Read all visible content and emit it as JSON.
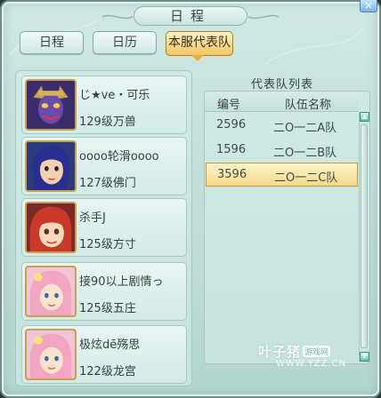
{
  "window": {
    "title": "日程",
    "close_label": "×"
  },
  "tabs": [
    {
      "label": "日程",
      "active": false
    },
    {
      "label": "日历",
      "active": false
    },
    {
      "label": "本服代表队",
      "active": true
    }
  ],
  "members": [
    {
      "name": "じ★ve・可乐",
      "level": "129级万兽",
      "icon": "avatar-demon-icon"
    },
    {
      "name": "oooo轮滑oooo",
      "level": "127级佛门",
      "icon": "avatar-blue-hair-icon"
    },
    {
      "name": "杀手J",
      "level": "125级方寸",
      "icon": "avatar-red-hair-icon"
    },
    {
      "name": "接90以上剧情っ",
      "level": "125级五庄",
      "icon": "avatar-pink-hair-icon"
    },
    {
      "name": "极炫dē殇思",
      "level": "122级龙宫",
      "icon": "avatar-pink-hair-icon"
    }
  ],
  "team_list": {
    "title": "代表队列表",
    "columns": [
      "编号",
      "队伍名称"
    ],
    "rows": [
      {
        "id": "2596",
        "name": "二O一二A队",
        "selected": false
      },
      {
        "id": "1596",
        "name": "二O一二B队",
        "selected": false
      },
      {
        "id": "3596",
        "name": "二O一二C队",
        "selected": true
      }
    ]
  },
  "watermark": {
    "main": "叶子猪",
    "tag": "游戏网",
    "url": "WWW.YZZ.CN"
  },
  "colors": {
    "panel_bg": "#bfded8",
    "tab_active": "#f5c560",
    "row_selected": "#f6d98a",
    "avatar_border": "#c9a14a"
  }
}
